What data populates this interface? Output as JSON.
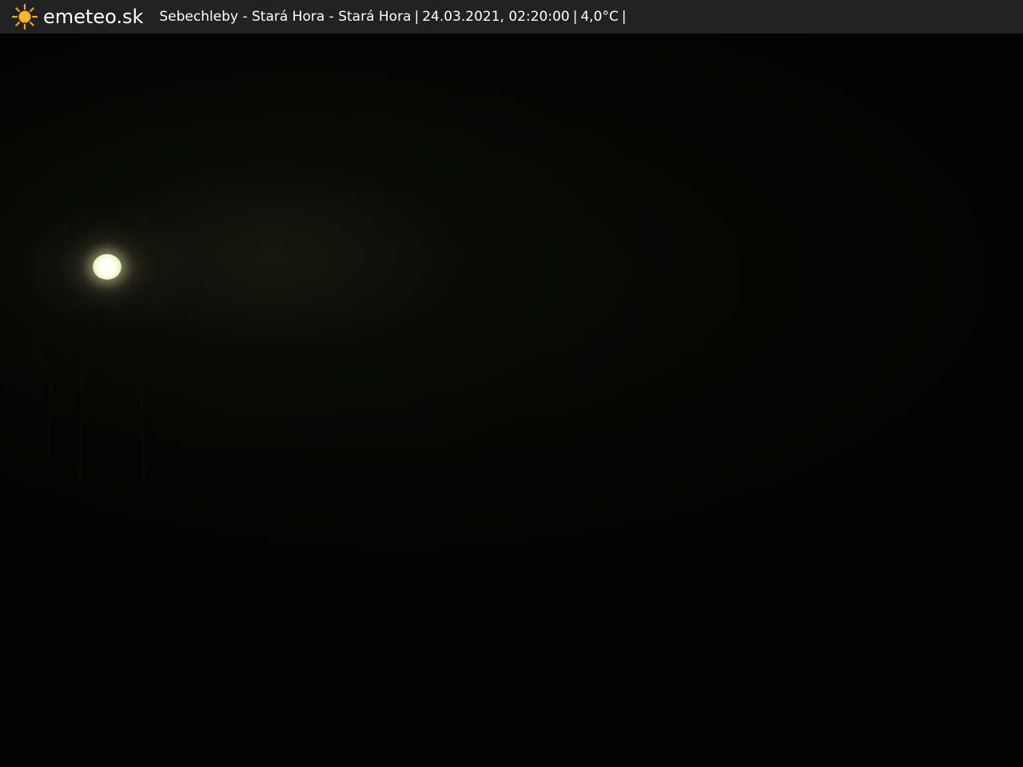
{
  "header": {
    "brand": "emeteo.sk",
    "logo_icon": "sun-icon",
    "location": "Sebechleby - Stará Hora - Stará Hora",
    "datetime": "24.03.2021, 02:20:00",
    "temperature": "4,0°C",
    "separator": "|"
  },
  "colors": {
    "header_bg": "#222222",
    "header_text": "#ffffff",
    "sun_orange": "#f5a623",
    "image_bg": "#020202"
  }
}
